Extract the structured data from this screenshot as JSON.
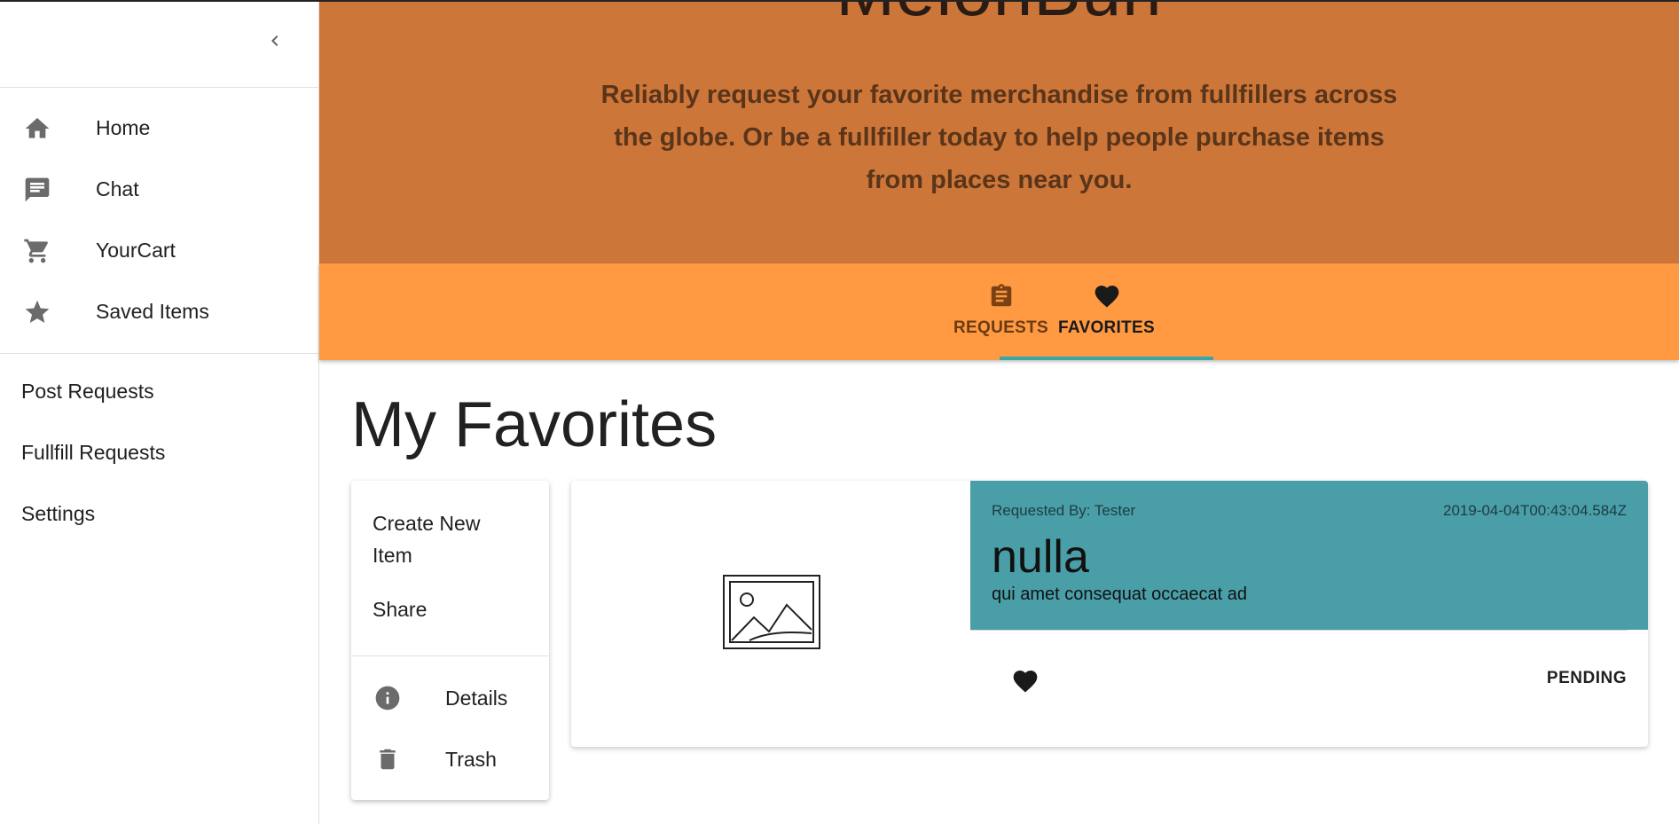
{
  "sidebar": {
    "collapse_icon": "chevron-left-icon",
    "nav_items": [
      {
        "label": "Home",
        "icon": "home-icon"
      },
      {
        "label": "Chat",
        "icon": "chat-icon"
      },
      {
        "label": "YourCart",
        "icon": "cart-icon"
      },
      {
        "label": "Saved Items",
        "icon": "star-icon"
      }
    ],
    "links": [
      {
        "label": "Post Requests"
      },
      {
        "label": "Fullfill Requests"
      },
      {
        "label": "Settings"
      }
    ]
  },
  "hero": {
    "brand": "MelonBun",
    "tagline": "Reliably request your favorite merchandise from fullfillers across the globe. Or be a fullfiller today to help people purchase items from places near you.",
    "background": "#cd763a"
  },
  "tabs": {
    "items": [
      {
        "label": "REQUESTS",
        "icon": "clipboard-icon"
      },
      {
        "label": "FAVORITES",
        "icon": "heart-icon"
      }
    ],
    "active": "FAVORITES",
    "background": "#ff9a42",
    "indicator_color": "#3aa6a8"
  },
  "main": {
    "title": "My Favorites"
  },
  "menu": {
    "create": "Create New Item",
    "share": "Share",
    "details": "Details",
    "trash": "Trash"
  },
  "item": {
    "requested_by": "Requested By: Tester",
    "timestamp": "2019-04-04T00:43:04.584Z",
    "title": "nulla",
    "description": "qui amet consequat occaecat ad",
    "status": "PENDING",
    "favorited": true,
    "accent": "#4a9ea8"
  }
}
